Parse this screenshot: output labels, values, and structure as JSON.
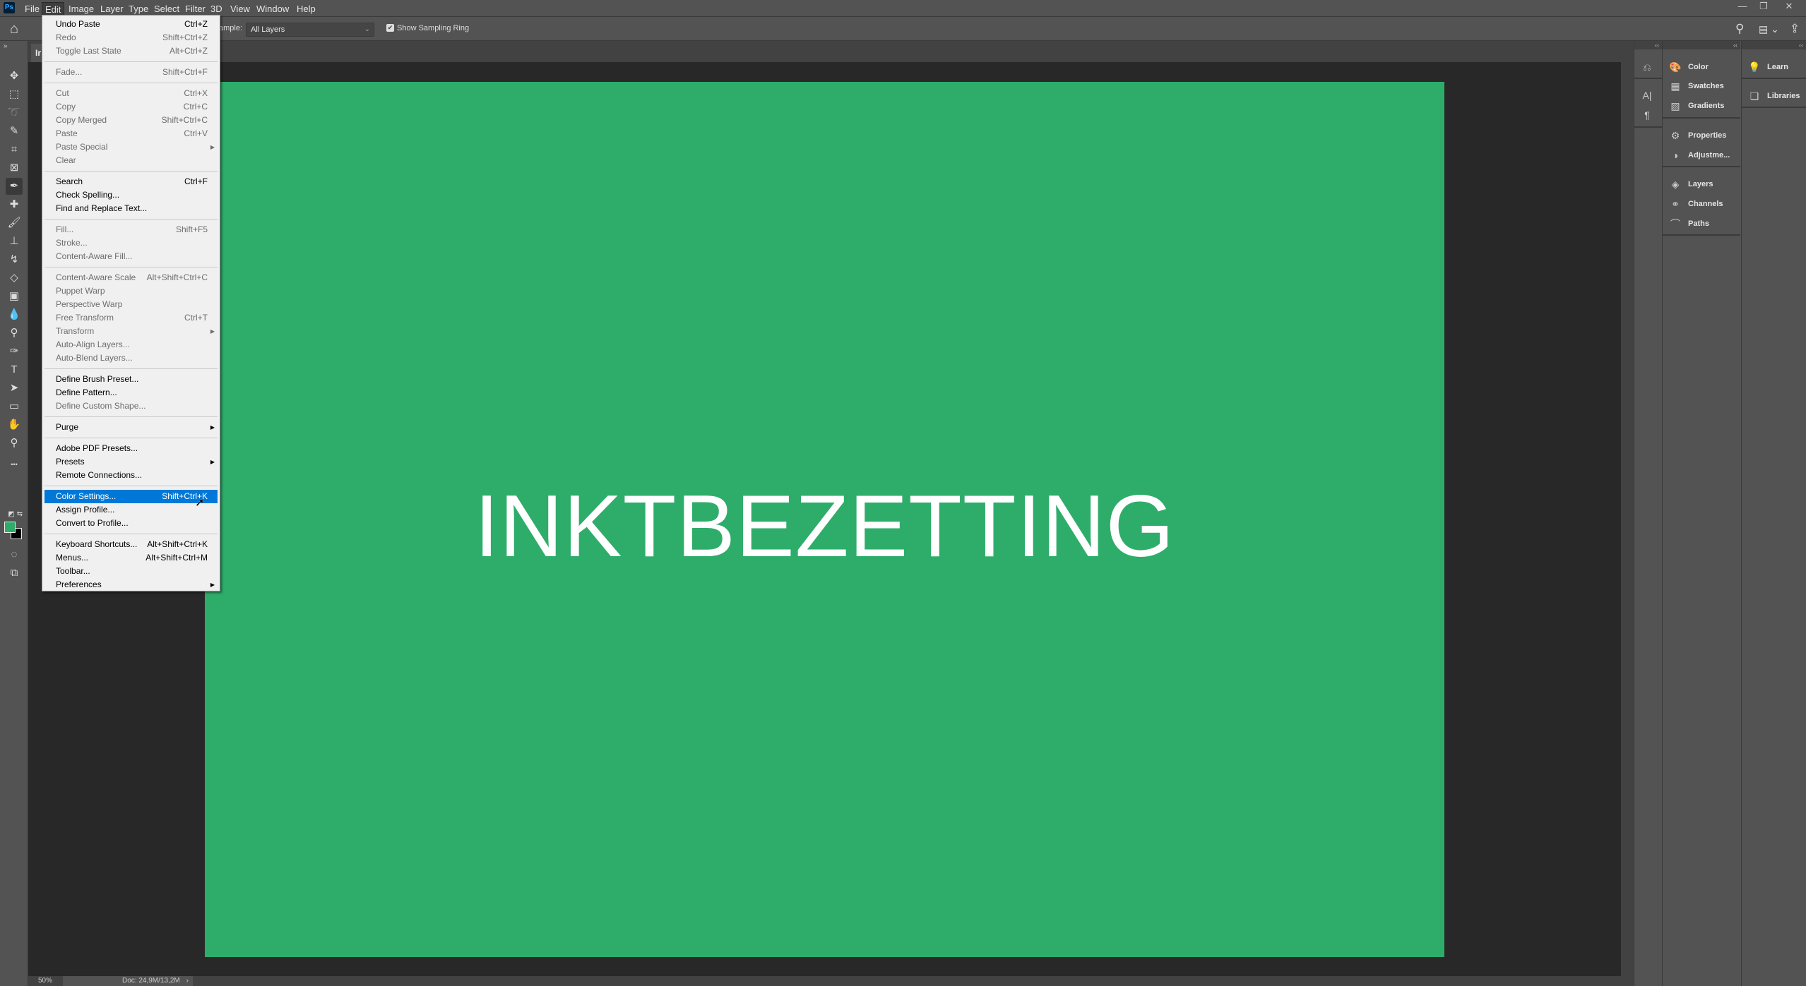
{
  "app": {
    "logo": "Ps"
  },
  "menubar": [
    "File",
    "Edit",
    "Image",
    "Layer",
    "Type",
    "Select",
    "Filter",
    "3D",
    "View",
    "Window",
    "Help"
  ],
  "window_controls": {
    "minimize": "—",
    "restore": "❐",
    "close": "✕"
  },
  "options": {
    "sample_label": "ample:",
    "sample_value": "All Layers",
    "show_sampling_ring": "Show Sampling Ring",
    "show_sampling_ring_checked": true
  },
  "document": {
    "tab_title": "Ir",
    "canvas_text": "INKTBEZETTING",
    "canvas_color": "#2ead6a",
    "zoom": "50%",
    "doc_info": "Doc: 24,9M/13,2M"
  },
  "colors": {
    "foreground": "#2ead6a",
    "background": "#000000",
    "highlight": "#0078d7"
  },
  "tools": [
    {
      "name": "move",
      "glyph": "✥"
    },
    {
      "name": "marquee",
      "glyph": "⬚"
    },
    {
      "name": "lasso",
      "glyph": "➰"
    },
    {
      "name": "quick-selection",
      "glyph": "✎"
    },
    {
      "name": "crop",
      "glyph": "⌗"
    },
    {
      "name": "frame",
      "glyph": "⊠"
    },
    {
      "name": "eyedropper",
      "glyph": "✒"
    },
    {
      "name": "healing-brush",
      "glyph": "✚"
    },
    {
      "name": "brush",
      "glyph": "🖌"
    },
    {
      "name": "clone-stamp",
      "glyph": "⊥"
    },
    {
      "name": "history-brush",
      "glyph": "↯"
    },
    {
      "name": "eraser",
      "glyph": "◇"
    },
    {
      "name": "gradient",
      "glyph": "▣"
    },
    {
      "name": "blur",
      "glyph": "💧"
    },
    {
      "name": "dodge",
      "glyph": "⚲"
    },
    {
      "name": "pen",
      "glyph": "✑"
    },
    {
      "name": "type",
      "glyph": "T"
    },
    {
      "name": "path-selection",
      "glyph": "➤"
    },
    {
      "name": "rectangle",
      "glyph": "▭"
    },
    {
      "name": "hand",
      "glyph": "✋"
    },
    {
      "name": "zoom",
      "glyph": "⚲"
    },
    {
      "name": "more",
      "glyph": "•••"
    }
  ],
  "panels": {
    "icon_column": [
      {
        "name": "history",
        "glyph": "⎌"
      },
      {
        "name": "character",
        "glyph": "A|"
      },
      {
        "name": "paragraph",
        "glyph": "¶"
      }
    ],
    "groups": [
      [
        {
          "label": "Color",
          "icon": "palette"
        },
        {
          "label": "Swatches",
          "icon": "grid"
        },
        {
          "label": "Gradients",
          "icon": "gradient"
        }
      ],
      [
        {
          "label": "Properties",
          "icon": "properties"
        },
        {
          "label": "Adjustme...",
          "icon": "adjustment"
        }
      ],
      [
        {
          "label": "Layers",
          "icon": "layers"
        },
        {
          "label": "Channels",
          "icon": "channels"
        },
        {
          "label": "Paths",
          "icon": "paths"
        }
      ]
    ],
    "right": [
      {
        "label": "Learn",
        "icon": "lightbulb"
      },
      {
        "label": "Libraries",
        "icon": "library"
      }
    ]
  },
  "edit_menu": [
    {
      "label": "Undo Paste",
      "shortcut": "Ctrl+Z"
    },
    {
      "label": "Redo",
      "shortcut": "Shift+Ctrl+Z",
      "disabled": true
    },
    {
      "label": "Toggle Last State",
      "shortcut": "Alt+Ctrl+Z",
      "disabled": true
    },
    {
      "sep": true
    },
    {
      "label": "Fade...",
      "shortcut": "Shift+Ctrl+F",
      "disabled": true
    },
    {
      "sep": true
    },
    {
      "label": "Cut",
      "shortcut": "Ctrl+X",
      "disabled": true
    },
    {
      "label": "Copy",
      "shortcut": "Ctrl+C",
      "disabled": true
    },
    {
      "label": "Copy Merged",
      "shortcut": "Shift+Ctrl+C",
      "disabled": true
    },
    {
      "label": "Paste",
      "shortcut": "Ctrl+V",
      "disabled": true
    },
    {
      "label": "Paste Special",
      "submenu": true,
      "disabled": true
    },
    {
      "label": "Clear",
      "disabled": true
    },
    {
      "sep": true
    },
    {
      "label": "Search",
      "shortcut": "Ctrl+F"
    },
    {
      "label": "Check Spelling..."
    },
    {
      "label": "Find and Replace Text..."
    },
    {
      "sep": true
    },
    {
      "label": "Fill...",
      "shortcut": "Shift+F5",
      "disabled": true
    },
    {
      "label": "Stroke...",
      "disabled": true
    },
    {
      "label": "Content-Aware Fill...",
      "disabled": true
    },
    {
      "sep": true
    },
    {
      "label": "Content-Aware Scale",
      "shortcut": "Alt+Shift+Ctrl+C",
      "disabled": true
    },
    {
      "label": "Puppet Warp",
      "disabled": true
    },
    {
      "label": "Perspective Warp",
      "disabled": true
    },
    {
      "label": "Free Transform",
      "shortcut": "Ctrl+T",
      "disabled": true
    },
    {
      "label": "Transform",
      "submenu": true,
      "disabled": true
    },
    {
      "label": "Auto-Align Layers...",
      "disabled": true
    },
    {
      "label": "Auto-Blend Layers...",
      "disabled": true
    },
    {
      "sep": true
    },
    {
      "label": "Define Brush Preset..."
    },
    {
      "label": "Define Pattern..."
    },
    {
      "label": "Define Custom Shape...",
      "disabled": true
    },
    {
      "sep": true
    },
    {
      "label": "Purge",
      "submenu": true
    },
    {
      "sep": true
    },
    {
      "label": "Adobe PDF Presets..."
    },
    {
      "label": "Presets",
      "submenu": true
    },
    {
      "label": "Remote Connections..."
    },
    {
      "sep": true
    },
    {
      "label": "Color Settings...",
      "shortcut": "Shift+Ctrl+K",
      "highlighted": true
    },
    {
      "label": "Assign Profile..."
    },
    {
      "label": "Convert to Profile..."
    },
    {
      "sep": true
    },
    {
      "label": "Keyboard Shortcuts...",
      "shortcut": "Alt+Shift+Ctrl+K"
    },
    {
      "label": "Menus...",
      "shortcut": "Alt+Shift+Ctrl+M"
    },
    {
      "label": "Toolbar..."
    },
    {
      "label": "Preferences",
      "submenu": true
    }
  ]
}
